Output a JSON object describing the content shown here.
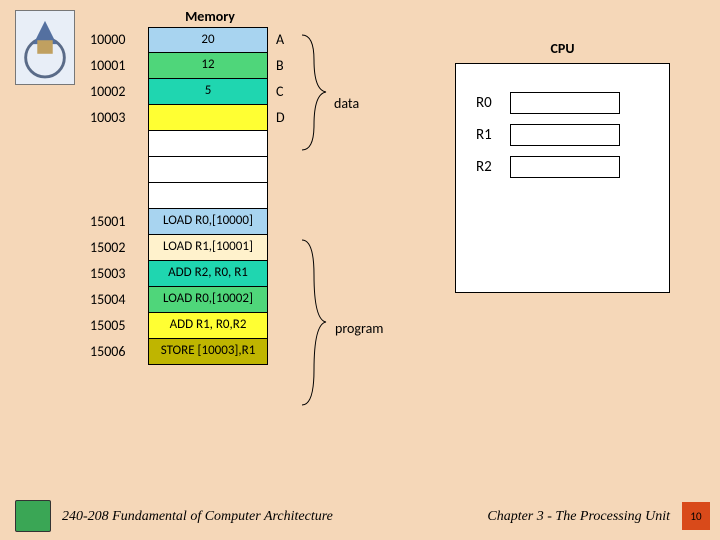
{
  "memory": {
    "title": "Memory",
    "rows": [
      {
        "addr": "10000",
        "value": "20",
        "label": "A",
        "color": "c-lblue"
      },
      {
        "addr": "10001",
        "value": "12",
        "label": "B",
        "color": "c-green"
      },
      {
        "addr": "10002",
        "value": "5",
        "label": "C",
        "color": "c-teal"
      },
      {
        "addr": "10003",
        "value": "",
        "label": "D",
        "color": "c-yellow"
      },
      {
        "addr": "",
        "value": "",
        "label": "",
        "color": "c-white"
      },
      {
        "addr": "",
        "value": "",
        "label": "",
        "color": "c-white"
      },
      {
        "addr": "",
        "value": "",
        "label": "",
        "color": "c-white"
      },
      {
        "addr": "15001",
        "value": "LOAD R0,[10000]",
        "label": "",
        "color": "c-lblue"
      },
      {
        "addr": "15002",
        "value": "LOAD R1,[10001]",
        "label": "",
        "color": "c-cream"
      },
      {
        "addr": "15003",
        "value": "ADD R2, R0, R1",
        "label": "",
        "color": "c-teal"
      },
      {
        "addr": "15004",
        "value": "LOAD R0,[10002]",
        "label": "",
        "color": "c-green"
      },
      {
        "addr": "15005",
        "value": "ADD R1, R0,R2",
        "label": "",
        "color": "c-yellow"
      },
      {
        "addr": "15006",
        "value": "STORE [10003],R1",
        "label": "",
        "color": "c-olive"
      }
    ]
  },
  "braces": {
    "data_label": "data",
    "program_label": "program"
  },
  "cpu": {
    "title": "CPU",
    "registers": [
      {
        "name": "R0",
        "value": ""
      },
      {
        "name": "R1",
        "value": ""
      },
      {
        "name": "R2",
        "value": ""
      }
    ]
  },
  "footer": {
    "course": "240-208 Fundamental of Computer Architecture",
    "chapter": "Chapter 3 - The Processing Unit",
    "page": "10"
  }
}
